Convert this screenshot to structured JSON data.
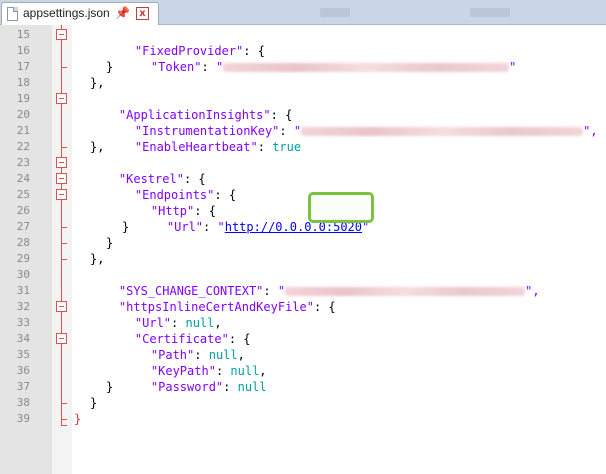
{
  "tab": {
    "filename": "appsettings.json",
    "pin_glyph": "📌",
    "close_glyph": "x"
  },
  "line_numbers": [
    "15",
    "16",
    "17",
    "18",
    "19",
    "20",
    "21",
    "22",
    "23",
    "24",
    "25",
    "26",
    "27",
    "28",
    "29",
    "30",
    "31",
    "32",
    "33",
    "34",
    "35",
    "36",
    "37",
    "38",
    "39"
  ],
  "code": {
    "l15": {
      "key": "\"FixedProvider\"",
      "rest": ": {"
    },
    "l16": {
      "key": "\"Token\"",
      "sep": ": ",
      "open": "\"",
      "close": "\""
    },
    "l17": {
      "text": "}"
    },
    "l18": {
      "text": "},"
    },
    "l19": {
      "key": "\"ApplicationInsights\"",
      "rest": ": {"
    },
    "l20": {
      "key": "\"InstrumentationKey\"",
      "sep": ": ",
      "open": "\"",
      "close": "\","
    },
    "l21": {
      "key": "\"EnableHeartbeat\"",
      "sep": ": ",
      "value": "true"
    },
    "l22": {
      "text": "},"
    },
    "l23": {
      "key": "\"Kestrel\"",
      "rest": ": {"
    },
    "l24": {
      "key": "\"Endpoints\"",
      "rest": ": {"
    },
    "l25": {
      "key": "\"Http\"",
      "rest": ": {"
    },
    "l26": {
      "key": "\"Url\"",
      "sep": ": ",
      "open": "\"",
      "url": "http://0.0.0.0:5020",
      "close": "\""
    },
    "l27": {
      "text": "}"
    },
    "l28": {
      "text": "}"
    },
    "l29": {
      "text": "},"
    },
    "l30": {
      "key": "\"SYS_CHANGE_CONTEXT\"",
      "sep": ": ",
      "open": "\"",
      "close": "\","
    },
    "l31": {
      "key": "\"httpsInlineCertAndKeyFile\"",
      "rest": ": {"
    },
    "l32": {
      "key": "\"Url\"",
      "sep": ": ",
      "value": "null",
      "tail": ","
    },
    "l33": {
      "key": "\"Certificate\"",
      "rest": ": {"
    },
    "l34": {
      "key": "\"Path\"",
      "sep": ": ",
      "value": "null",
      "tail": ","
    },
    "l35": {
      "key": "\"KeyPath\"",
      "sep": ": ",
      "value": "null",
      "tail": ","
    },
    "l36": {
      "key": "\"Password\"",
      "sep": ": ",
      "value": "null"
    },
    "l37": {
      "text": "}"
    },
    "l38": {
      "text": "}"
    },
    "l39": {
      "text": "}"
    }
  },
  "colors": {
    "key": "#8000ff",
    "keyword": "#00a0a0",
    "link": "#0000ff",
    "fold": "#d9534f",
    "highlight": "#7cc142"
  }
}
